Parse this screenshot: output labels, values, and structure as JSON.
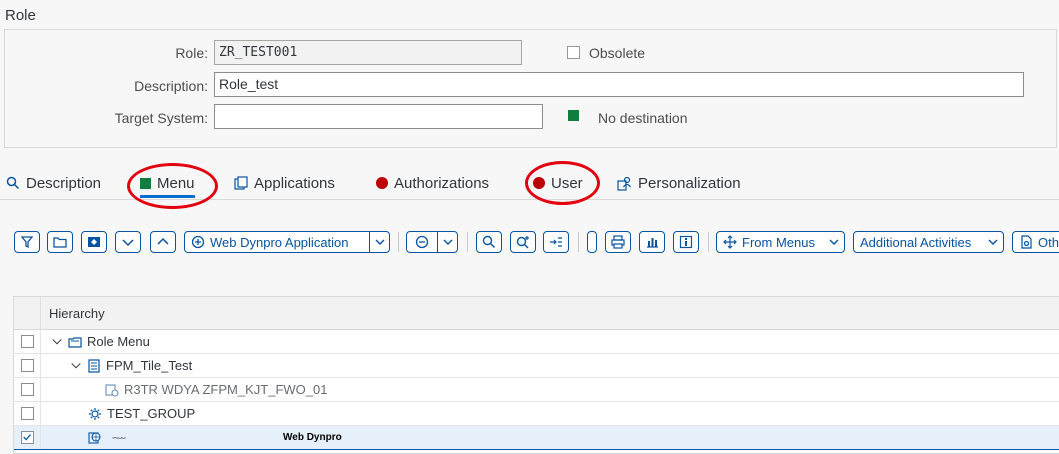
{
  "page": {
    "title": "Role"
  },
  "form": {
    "role_label": "Role:",
    "role_value": "ZR_TEST001",
    "obsolete_label": "Obsolete",
    "description_label": "Description:",
    "description_value": "Role_test",
    "target_system_label": "Target System:",
    "target_system_value": "",
    "destination_status": "No destination"
  },
  "tabs": [
    {
      "label": "Description",
      "icon": "search-icon"
    },
    {
      "label": "Menu",
      "icon": "green-status-icon",
      "active": true
    },
    {
      "label": "Applications",
      "icon": "applications-icon"
    },
    {
      "label": "Authorizations",
      "icon": "red-status-icon"
    },
    {
      "label": "User",
      "icon": "red-status-icon"
    },
    {
      "label": "Personalization",
      "icon": "personalization-icon"
    }
  ],
  "toolbar": {
    "web_dynpro_label": "Web Dynpro Application",
    "from_menus_label": "From Menus",
    "additional_activities_label": "Additional Activities",
    "other_label": "Oth"
  },
  "tree": {
    "header": "Hierarchy",
    "rows": [
      {
        "label": "Role Menu",
        "checked": false
      },
      {
        "label": "FPM_Tile_Test",
        "checked": false
      },
      {
        "label": "R3TR WDYA ZFPM_KJT_FWO_01",
        "checked": false
      },
      {
        "label": "TEST_GROUP",
        "checked": false
      },
      {
        "label": "",
        "type_label": "Web Dynpro",
        "checked": true
      }
    ]
  },
  "colors": {
    "accent": "#0854a0",
    "status_green": "#107e3e",
    "status_red": "#bb0000",
    "highlight_ring": "#e3000f"
  }
}
